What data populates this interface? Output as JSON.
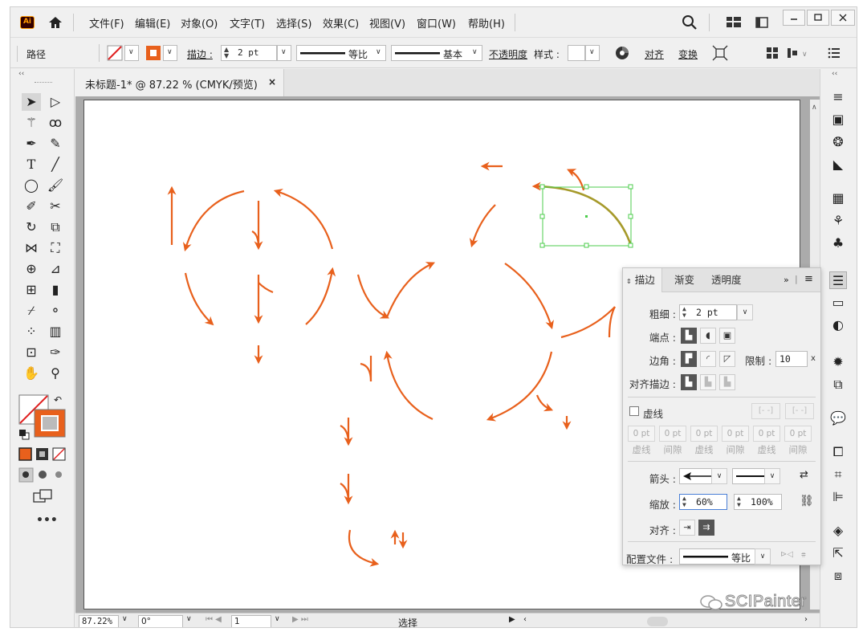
{
  "app": {
    "logo": "Ai"
  },
  "menu": [
    "文件(F)",
    "编辑(E)",
    "对象(O)",
    "文字(T)",
    "选择(S)",
    "效果(C)",
    "视图(V)",
    "窗口(W)",
    "帮助(H)"
  ],
  "control": {
    "object_type": "路径",
    "stroke_label": "描边 :",
    "stroke_weight": "2 pt",
    "profile_label": "等比",
    "brush_label": "基本",
    "opacity_label": "不透明度",
    "style_label": "样式 :",
    "align_label": "对齐",
    "transform_label": "变换"
  },
  "document": {
    "tab_title": "未标题-1* @ 87.22 % (CMYK/预览)"
  },
  "stroke_panel": {
    "tabs": [
      "描边",
      "渐变",
      "透明度"
    ],
    "weight_label": "粗细 :",
    "weight_value": "2 pt",
    "cap_label": "端点 :",
    "corner_label": "边角 :",
    "limit_label": "限制 :",
    "limit_value": "10",
    "limit_unit": "x",
    "align_label": "对齐描边 :",
    "dash_label": "虚线",
    "dash_values": [
      "0 pt",
      "0 pt",
      "0 pt",
      "0 pt",
      "0 pt",
      "0 pt"
    ],
    "dash_headers": [
      "虚线",
      "间隙",
      "虚线",
      "间隙",
      "虚线",
      "间隙"
    ],
    "arrow_label": "箭头 :",
    "scale_label": "缩放 :",
    "scale_start": "60%",
    "scale_end": "100%",
    "arrow_align_label": "对齐 :",
    "profile_label": "配置文件 :",
    "profile_value": "等比"
  },
  "status": {
    "zoom": "87.22%",
    "rotation": "0°",
    "artboard": "1",
    "tool": "选择"
  },
  "watermark": "SCIPainter",
  "colors": {
    "accent": "#e8601c",
    "selection": "#4ccd4c",
    "selected_path": "#a69a2b"
  },
  "icons": {
    "home": "home-icon",
    "search": "search-icon",
    "minimize": "minimize-icon",
    "maximize": "maximize-icon",
    "close": "close-icon"
  }
}
